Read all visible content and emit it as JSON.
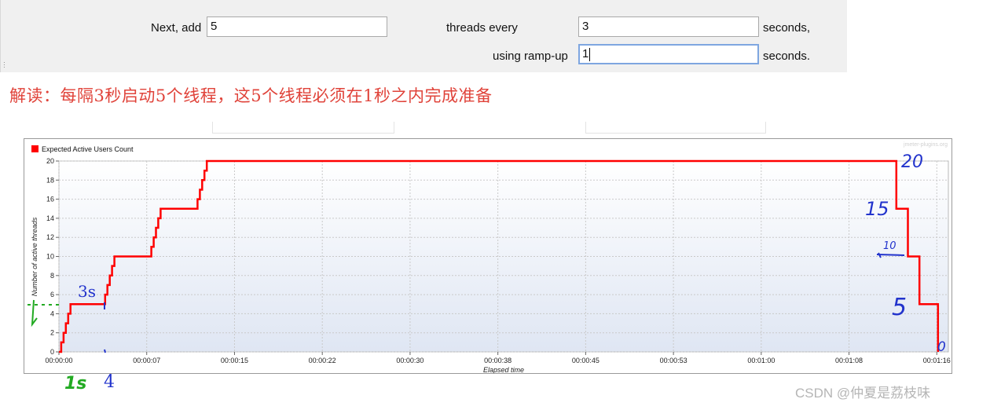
{
  "form": {
    "next_add_label": "Next, add",
    "next_add_value": "5",
    "threads_every_label": "threads every",
    "threads_every_value": "3",
    "seconds_label_1": "seconds,",
    "ramp_up_label": "using ramp-up",
    "ramp_up_value": "1",
    "seconds_label_2": "seconds."
  },
  "annotation_text": "解读：每隔3秒启动5个线程，这5个线程必须在1秒之内完成准备",
  "handwritten": {
    "label_3s": "3s",
    "label_1s": "1s",
    "label_4": "4",
    "label_20": "20",
    "label_15": "15",
    "label_10": "10",
    "label_5": "5",
    "label_0": "0"
  },
  "watermark": "CSDN @仲夏是荔枝味",
  "colors": {
    "series": "#ff0000",
    "annotation_red": "#e0433a",
    "handwriting_blue": "#2233cc",
    "handwriting_green": "#22aa22"
  },
  "chart_data": {
    "type": "line",
    "title": "",
    "legend": [
      "Expected Active Users Count"
    ],
    "legend_position": "top-left",
    "source_mark": "jmeter-plugins.org",
    "xlabel": "Elapsed time",
    "ylabel": "Number of active threads",
    "xlim": [
      0,
      77
    ],
    "ylim": [
      0,
      20
    ],
    "grid": true,
    "x_ticks": [
      "00:00:00",
      "00:00:07",
      "00:00:15",
      "00:00:22",
      "00:00:30",
      "00:00:38",
      "00:00:45",
      "00:00:53",
      "00:01:00",
      "00:01:08",
      "00:01:16"
    ],
    "x_tick_values": [
      0,
      7.6,
      15.2,
      22.8,
      30.4,
      38,
      45.6,
      53.2,
      60.8,
      68.4,
      76
    ],
    "y_ticks": [
      0,
      2,
      4,
      6,
      8,
      10,
      12,
      14,
      16,
      18,
      20
    ],
    "series": [
      {
        "name": "Expected Active Users Count",
        "x": [
          0,
          0.2,
          0.2,
          0.4,
          0.4,
          0.6,
          0.6,
          0.8,
          0.8,
          1,
          1,
          4,
          4,
          4.2,
          4.2,
          4.4,
          4.4,
          4.6,
          4.6,
          4.8,
          4.8,
          5,
          5,
          8,
          8,
          8.2,
          8.2,
          8.4,
          8.4,
          8.6,
          8.6,
          8.8,
          8.8,
          9,
          9,
          12,
          12,
          12.2,
          12.2,
          12.4,
          12.4,
          12.6,
          12.6,
          12.8,
          12.8,
          13,
          13,
          72.5,
          72.5,
          73.5,
          73.5,
          74.5,
          74.5,
          75.5,
          75.5,
          76.1,
          76.1
        ],
        "y": [
          0,
          0,
          1,
          1,
          2,
          2,
          3,
          3,
          4,
          4,
          5,
          5,
          6,
          6,
          7,
          7,
          8,
          8,
          9,
          9,
          10,
          10,
          10,
          10,
          11,
          11,
          12,
          12,
          13,
          13,
          14,
          14,
          15,
          15,
          15,
          15,
          16,
          16,
          17,
          17,
          18,
          18,
          19,
          19,
          20,
          20,
          20,
          20,
          15,
          15,
          10,
          10,
          5,
          5,
          5,
          5,
          0
        ]
      }
    ]
  }
}
